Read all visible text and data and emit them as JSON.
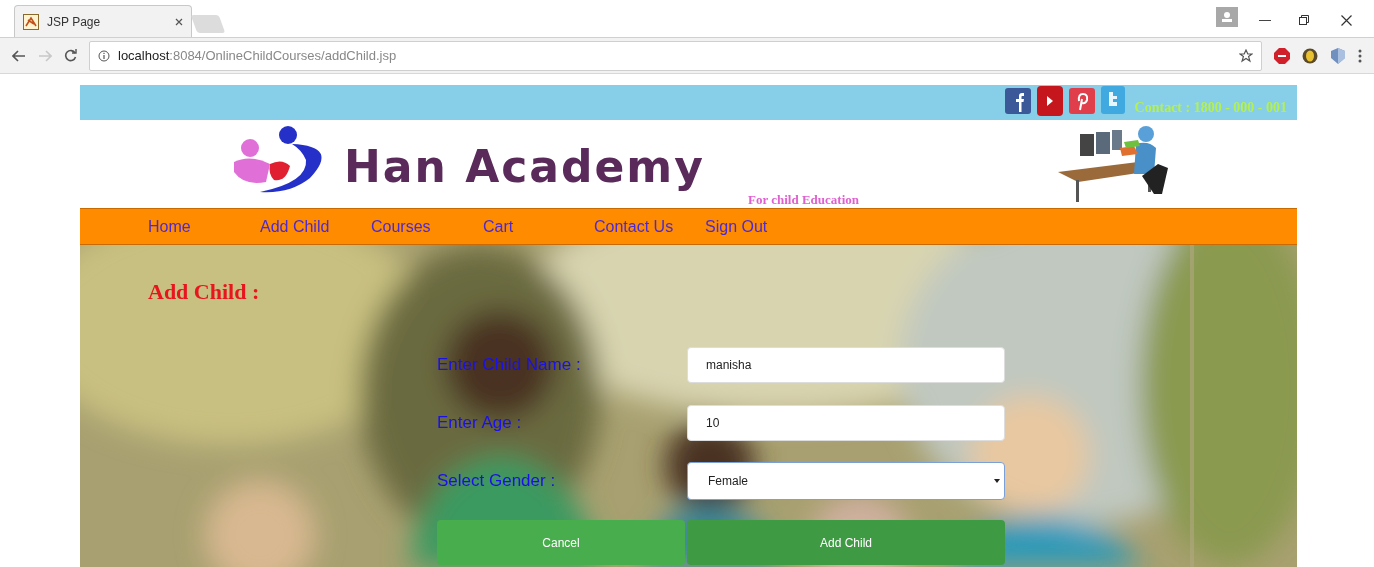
{
  "browser": {
    "tab_title": "JSP Page",
    "url_host": "localhost",
    "url_path": ":8084/OnlineChildCourses/addChild.jsp"
  },
  "top_bar": {
    "contact": "Contact : 1800 - 000 - 001"
  },
  "header": {
    "brand": "Han Academy",
    "tagline": "For child Education"
  },
  "nav": [
    {
      "label": "Home"
    },
    {
      "label": "Add Child"
    },
    {
      "label": "Courses"
    },
    {
      "label": "Cart"
    },
    {
      "label": "Contact Us"
    },
    {
      "label": "Sign Out"
    }
  ],
  "form": {
    "heading": "Add Child :",
    "fields": [
      {
        "kind": "text",
        "label": "Enter Child Name :",
        "value": "manisha"
      },
      {
        "kind": "text",
        "label": "Enter Age :",
        "value": "10"
      },
      {
        "kind": "select",
        "label": "Select Gender :",
        "value": "Female"
      }
    ],
    "buttons": [
      {
        "label": "Cancel"
      },
      {
        "label": "Add Child"
      }
    ]
  }
}
